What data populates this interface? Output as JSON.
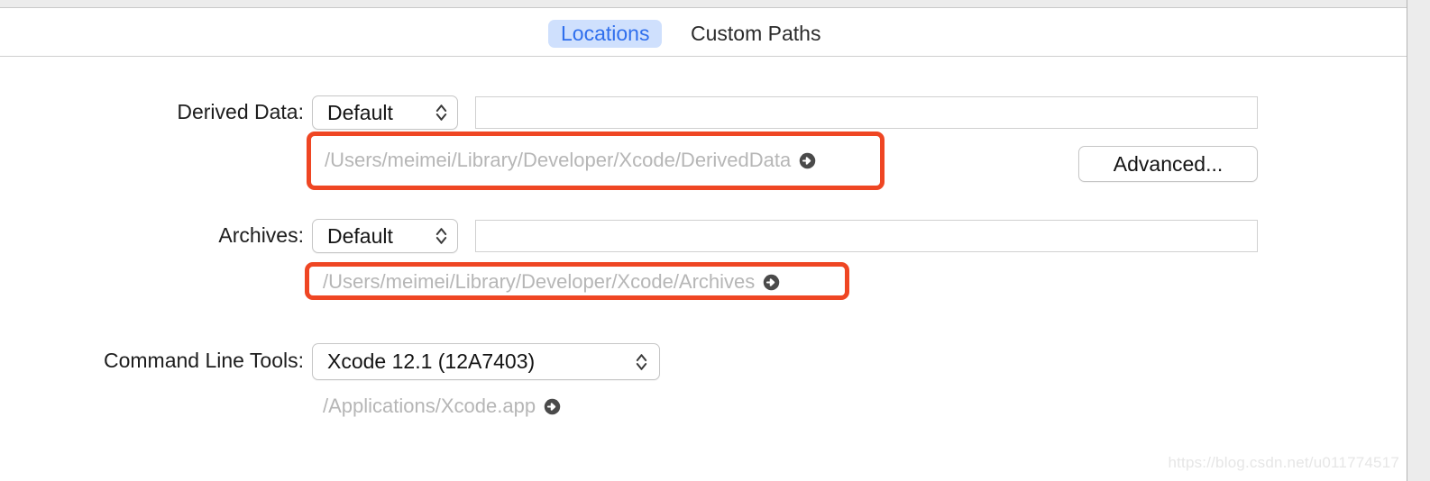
{
  "window": {
    "accent_blue": "#2f6fed",
    "tab_selected_bg": "#cfe0fd",
    "annotation_color": "#ef4623",
    "path_text_color": "#b6b6b6"
  },
  "tabs": [
    {
      "id": "locations",
      "label": "Locations",
      "selected": true
    },
    {
      "id": "custom_paths",
      "label": "Custom Paths",
      "selected": false
    }
  ],
  "rows": {
    "derived_data": {
      "label": "Derived Data:",
      "popup_value": "Default",
      "field_value": "",
      "field_placeholder": "",
      "path": "/Users/meimei/Library/Developer/Xcode/DerivedData",
      "reveal_icon": "reveal-in-finder-icon",
      "annotated": true
    },
    "archives": {
      "label": "Archives:",
      "popup_value": "Default",
      "field_value": "",
      "field_placeholder": "",
      "path": "/Users/meimei/Library/Developer/Xcode/Archives",
      "reveal_icon": "reveal-in-finder-icon",
      "annotated": true
    },
    "command_line_tools": {
      "label": "Command Line Tools:",
      "popup_value": "Xcode 12.1 (12A7403)",
      "path": "/Applications/Xcode.app",
      "reveal_icon": "reveal-in-finder-icon",
      "annotated": false
    }
  },
  "buttons": {
    "advanced": "Advanced..."
  },
  "watermark": {
    "text": "https://blog.csdn.net/u011774517"
  }
}
